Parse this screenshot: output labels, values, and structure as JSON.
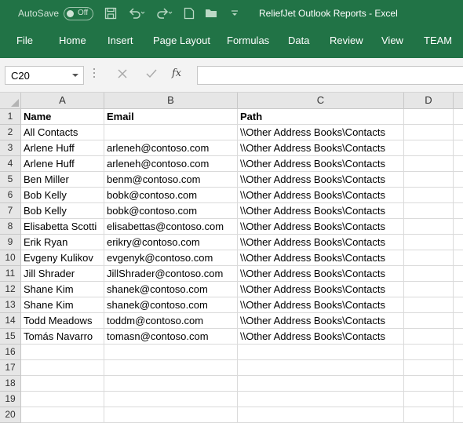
{
  "titlebar": {
    "autosave_label": "AutoSave",
    "autosave_state": "Off",
    "title": "ReliefJet Outlook Reports  -  Excel",
    "icons": [
      "save-icon",
      "undo-icon",
      "redo-icon",
      "new-file-icon",
      "open-folder-icon",
      "customize-quick-access-icon"
    ]
  },
  "ribbon": {
    "tabs": [
      "File",
      "Home",
      "Insert",
      "Page Layout",
      "Formulas",
      "Data",
      "Review",
      "View",
      "TEAM"
    ]
  },
  "formula_bar": {
    "name_box": "C20",
    "fx_label": "fx",
    "formula": ""
  },
  "sheet": {
    "columns": [
      "A",
      "B",
      "C",
      "D"
    ],
    "rows": [
      {
        "num": "1",
        "cells": [
          "Name",
          "Email",
          "Path",
          ""
        ]
      },
      {
        "num": "2",
        "cells": [
          "All Contacts",
          "",
          "\\\\Other Address Books\\Contacts",
          ""
        ]
      },
      {
        "num": "3",
        "cells": [
          "Arlene Huff",
          "arleneh@contoso.com",
          "\\\\Other Address Books\\Contacts",
          ""
        ]
      },
      {
        "num": "4",
        "cells": [
          "Arlene Huff",
          "arleneh@contoso.com",
          "\\\\Other Address Books\\Contacts",
          ""
        ]
      },
      {
        "num": "5",
        "cells": [
          "Ben Miller",
          "benm@contoso.com",
          "\\\\Other Address Books\\Contacts",
          ""
        ]
      },
      {
        "num": "6",
        "cells": [
          "Bob Kelly",
          "bobk@contoso.com",
          "\\\\Other Address Books\\Contacts",
          ""
        ]
      },
      {
        "num": "7",
        "cells": [
          "Bob Kelly",
          "bobk@contoso.com",
          "\\\\Other Address Books\\Contacts",
          ""
        ]
      },
      {
        "num": "8",
        "cells": [
          "Elisabetta Scotti",
          "elisabettas@contoso.com",
          "\\\\Other Address Books\\Contacts",
          ""
        ]
      },
      {
        "num": "9",
        "cells": [
          "Erik Ryan",
          "erikry@contoso.com",
          "\\\\Other Address Books\\Contacts",
          ""
        ]
      },
      {
        "num": "10",
        "cells": [
          "Evgeny Kulikov",
          "evgenyk@contoso.com",
          "\\\\Other Address Books\\Contacts",
          ""
        ]
      },
      {
        "num": "11",
        "cells": [
          "Jill Shrader",
          "JillShrader@contoso.com",
          "\\\\Other Address Books\\Contacts",
          ""
        ]
      },
      {
        "num": "12",
        "cells": [
          "Shane Kim",
          "shanek@contoso.com",
          "\\\\Other Address Books\\Contacts",
          ""
        ]
      },
      {
        "num": "13",
        "cells": [
          "Shane Kim",
          "shanek@contoso.com",
          "\\\\Other Address Books\\Contacts",
          ""
        ]
      },
      {
        "num": "14",
        "cells": [
          "Todd Meadows",
          "toddm@contoso.com",
          "\\\\Other Address Books\\Contacts",
          ""
        ]
      },
      {
        "num": "15",
        "cells": [
          "Tomás Navarro",
          "tomasn@contoso.com",
          "\\\\Other Address Books\\Contacts",
          ""
        ]
      },
      {
        "num": "16",
        "cells": [
          "",
          "",
          "",
          ""
        ]
      },
      {
        "num": "17",
        "cells": [
          "",
          "",
          "",
          ""
        ]
      },
      {
        "num": "18",
        "cells": [
          "",
          "",
          "",
          ""
        ]
      },
      {
        "num": "19",
        "cells": [
          "",
          "",
          "",
          ""
        ]
      },
      {
        "num": "20",
        "cells": [
          "",
          "",
          "",
          ""
        ]
      }
    ]
  },
  "colors": {
    "excel_green": "#217346",
    "header_gray": "#e6e6e6"
  }
}
